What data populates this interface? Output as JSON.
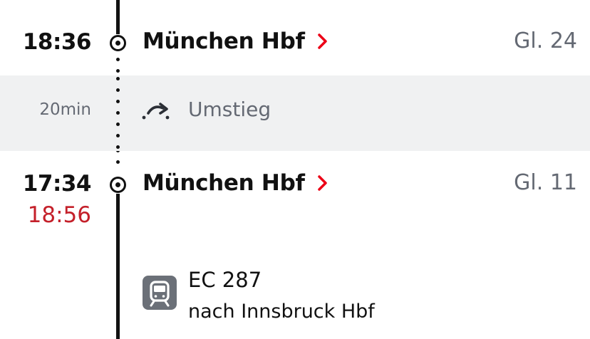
{
  "stops": [
    {
      "time": "18:36",
      "station": "München Hbf",
      "platform": "Gl. 24"
    },
    {
      "time": "17:34",
      "delayed_time": "18:56",
      "station": "München Hbf",
      "platform": "Gl. 11"
    }
  ],
  "transfer": {
    "duration": "20min",
    "label": "Umstieg",
    "icon": "transfer-arrow-icon"
  },
  "train": {
    "icon": "train-icon",
    "name": "EC 287",
    "destination": "nach Innsbruck Hbf"
  },
  "colors": {
    "delay": "#c4202a",
    "chevron": "#ec0016",
    "muted_text": "#646973",
    "transfer_background": "#f0f1f2",
    "train_icon_background": "#6b7078"
  }
}
